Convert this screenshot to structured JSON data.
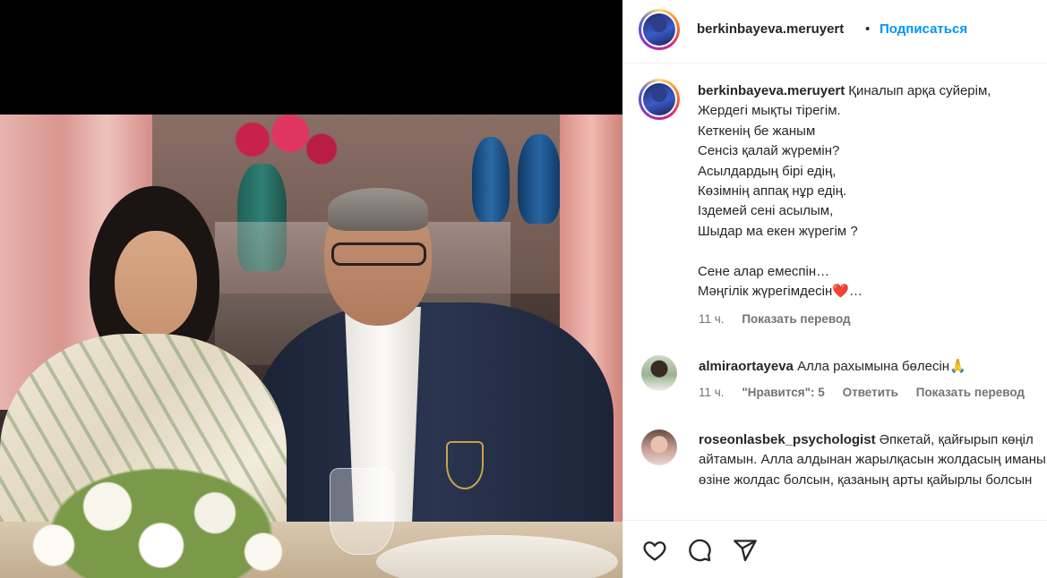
{
  "post": {
    "author": "berkinbayeva.meruyert",
    "separator": "•",
    "follow_label": "Подписаться",
    "caption_lines": "Қиналып арқа суйерім,\nЖердегі мықты тірегім.\nКеткенің бе жаным\nСенсіз қалай жүремін?\nАсылдардың бірі едің,\nКөзімнің аппақ нұр едің.\nІздемей сені асылым,\nШыдар ма екен жүрегім ?\n\nСене алар емеспін…\nМәңгілік жүрегімдесін❤️…",
    "time": "11 ч.",
    "translate_label": "Показать перевод"
  },
  "comments": [
    {
      "user": "almiraortayeva",
      "text": "Алла рахымына бөлесін🙏",
      "time": "11 ч.",
      "likes": "\"Нравится\": 5",
      "reply_label": "Ответить",
      "translate_label": "Показать перевод"
    },
    {
      "user": "roseonlasbek_psychologist",
      "text": "Әпкетай, қайғырып көңіл айтамын. Алла алдынан жарылқасын жолдасың иманы өзіне жолдас болсын, қазаның арты қайырлы болсын"
    }
  ],
  "actions": {
    "like": "heart-icon",
    "comment": "comment-icon",
    "share": "share-icon"
  }
}
